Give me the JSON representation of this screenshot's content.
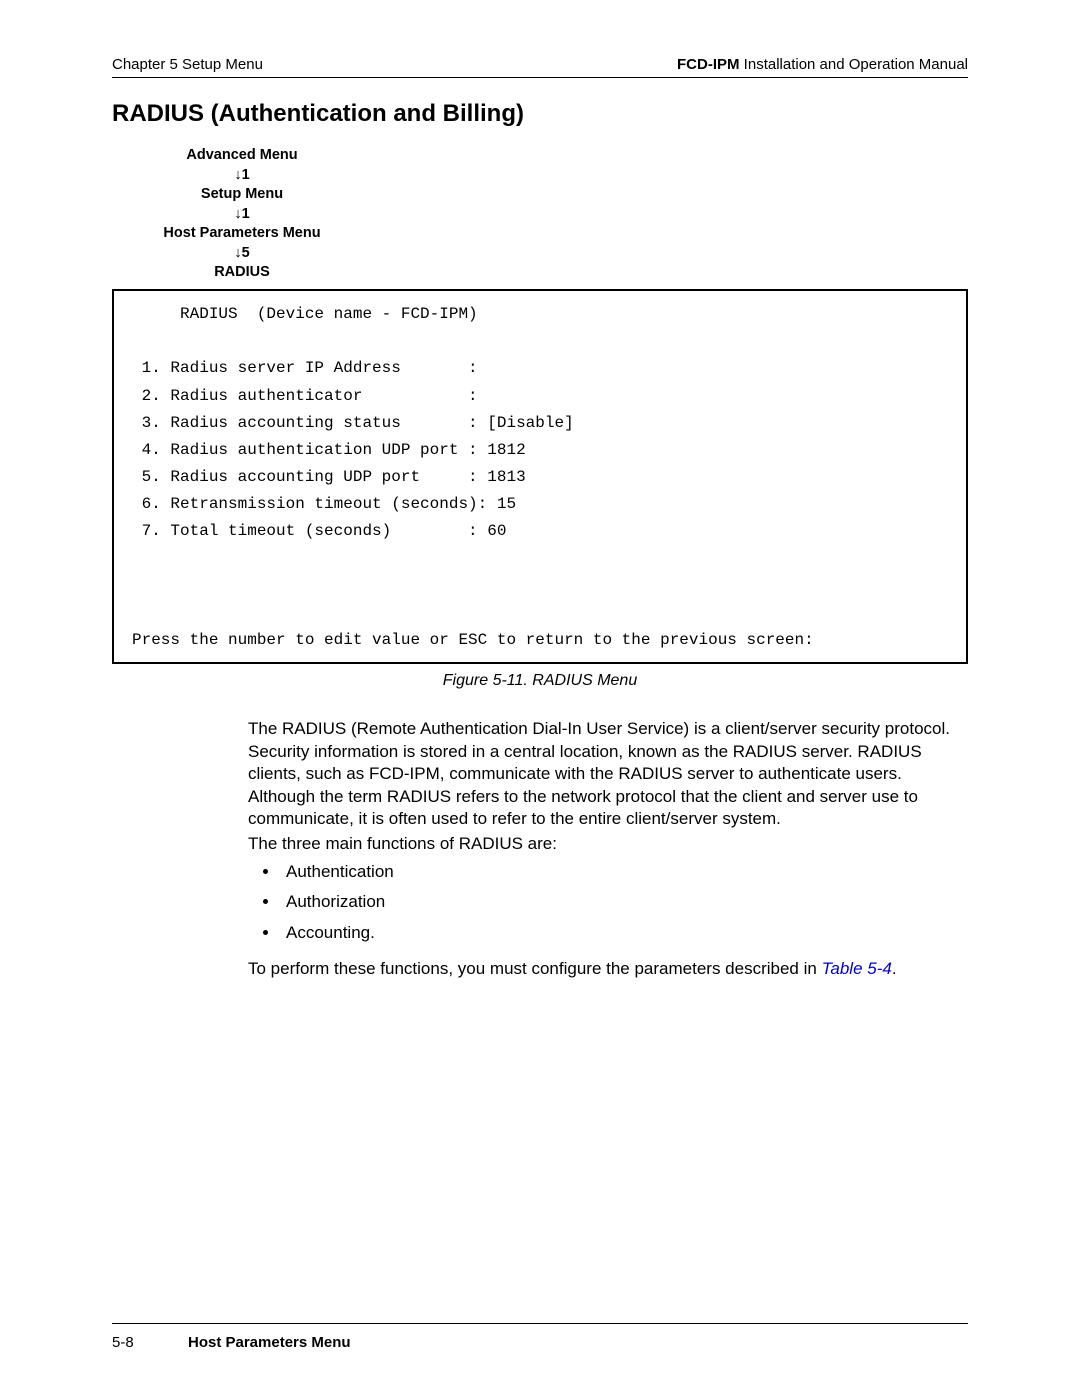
{
  "header": {
    "left": "Chapter 5  Setup Menu",
    "right_bold": "FCD-IPM",
    "right_rest": " Installation and Operation Manual"
  },
  "title": "RADIUS (Authentication and Billing)",
  "breadcrumb": {
    "l1": "Advanced Menu",
    "a1": "↓1",
    "l2": "Setup Menu",
    "a2": "↓1",
    "l3": "Host Parameters Menu",
    "a3": "↓5",
    "l4": "RADIUS"
  },
  "terminal": {
    "title": "     RADIUS  (Device name - FCD-IPM)",
    "blank": " ",
    "r1": " 1. Radius server IP Address       :",
    "r2": " 2. Radius authenticator           :",
    "r3": " 3. Radius accounting status       : [Disable]",
    "r4": " 4. Radius authentication UDP port : 1812",
    "r5": " 5. Radius accounting UDP port     : 1813",
    "r6": " 6. Retransmission timeout (seconds): 15",
    "r7": " 7. Total timeout (seconds)        : 60",
    "prompt": "Press the number to edit value or ESC to return to the previous screen:"
  },
  "caption": "Figure 5-11.  RADIUS Menu",
  "para1": "The RADIUS (Remote Authentication Dial-In User Service) is a client/server security protocol. Security information is stored in a central location, known as the RADIUS server. RADIUS clients, such as FCD-IPM, communicate with the RADIUS server to authenticate users. Although the term RADIUS refers to the network protocol that the client and server use to communicate, it is often used to refer to the entire client/server system.",
  "para2": "The three main functions of RADIUS are:",
  "bullets": {
    "b1": "Authentication",
    "b2": "Authorization",
    "b3": "Accounting."
  },
  "para3a": "To perform these functions, you must configure the parameters described in ",
  "para3_link": "Table 5-4",
  "para3b": ".",
  "footer": {
    "page": "5-8",
    "section": "Host Parameters Menu"
  }
}
